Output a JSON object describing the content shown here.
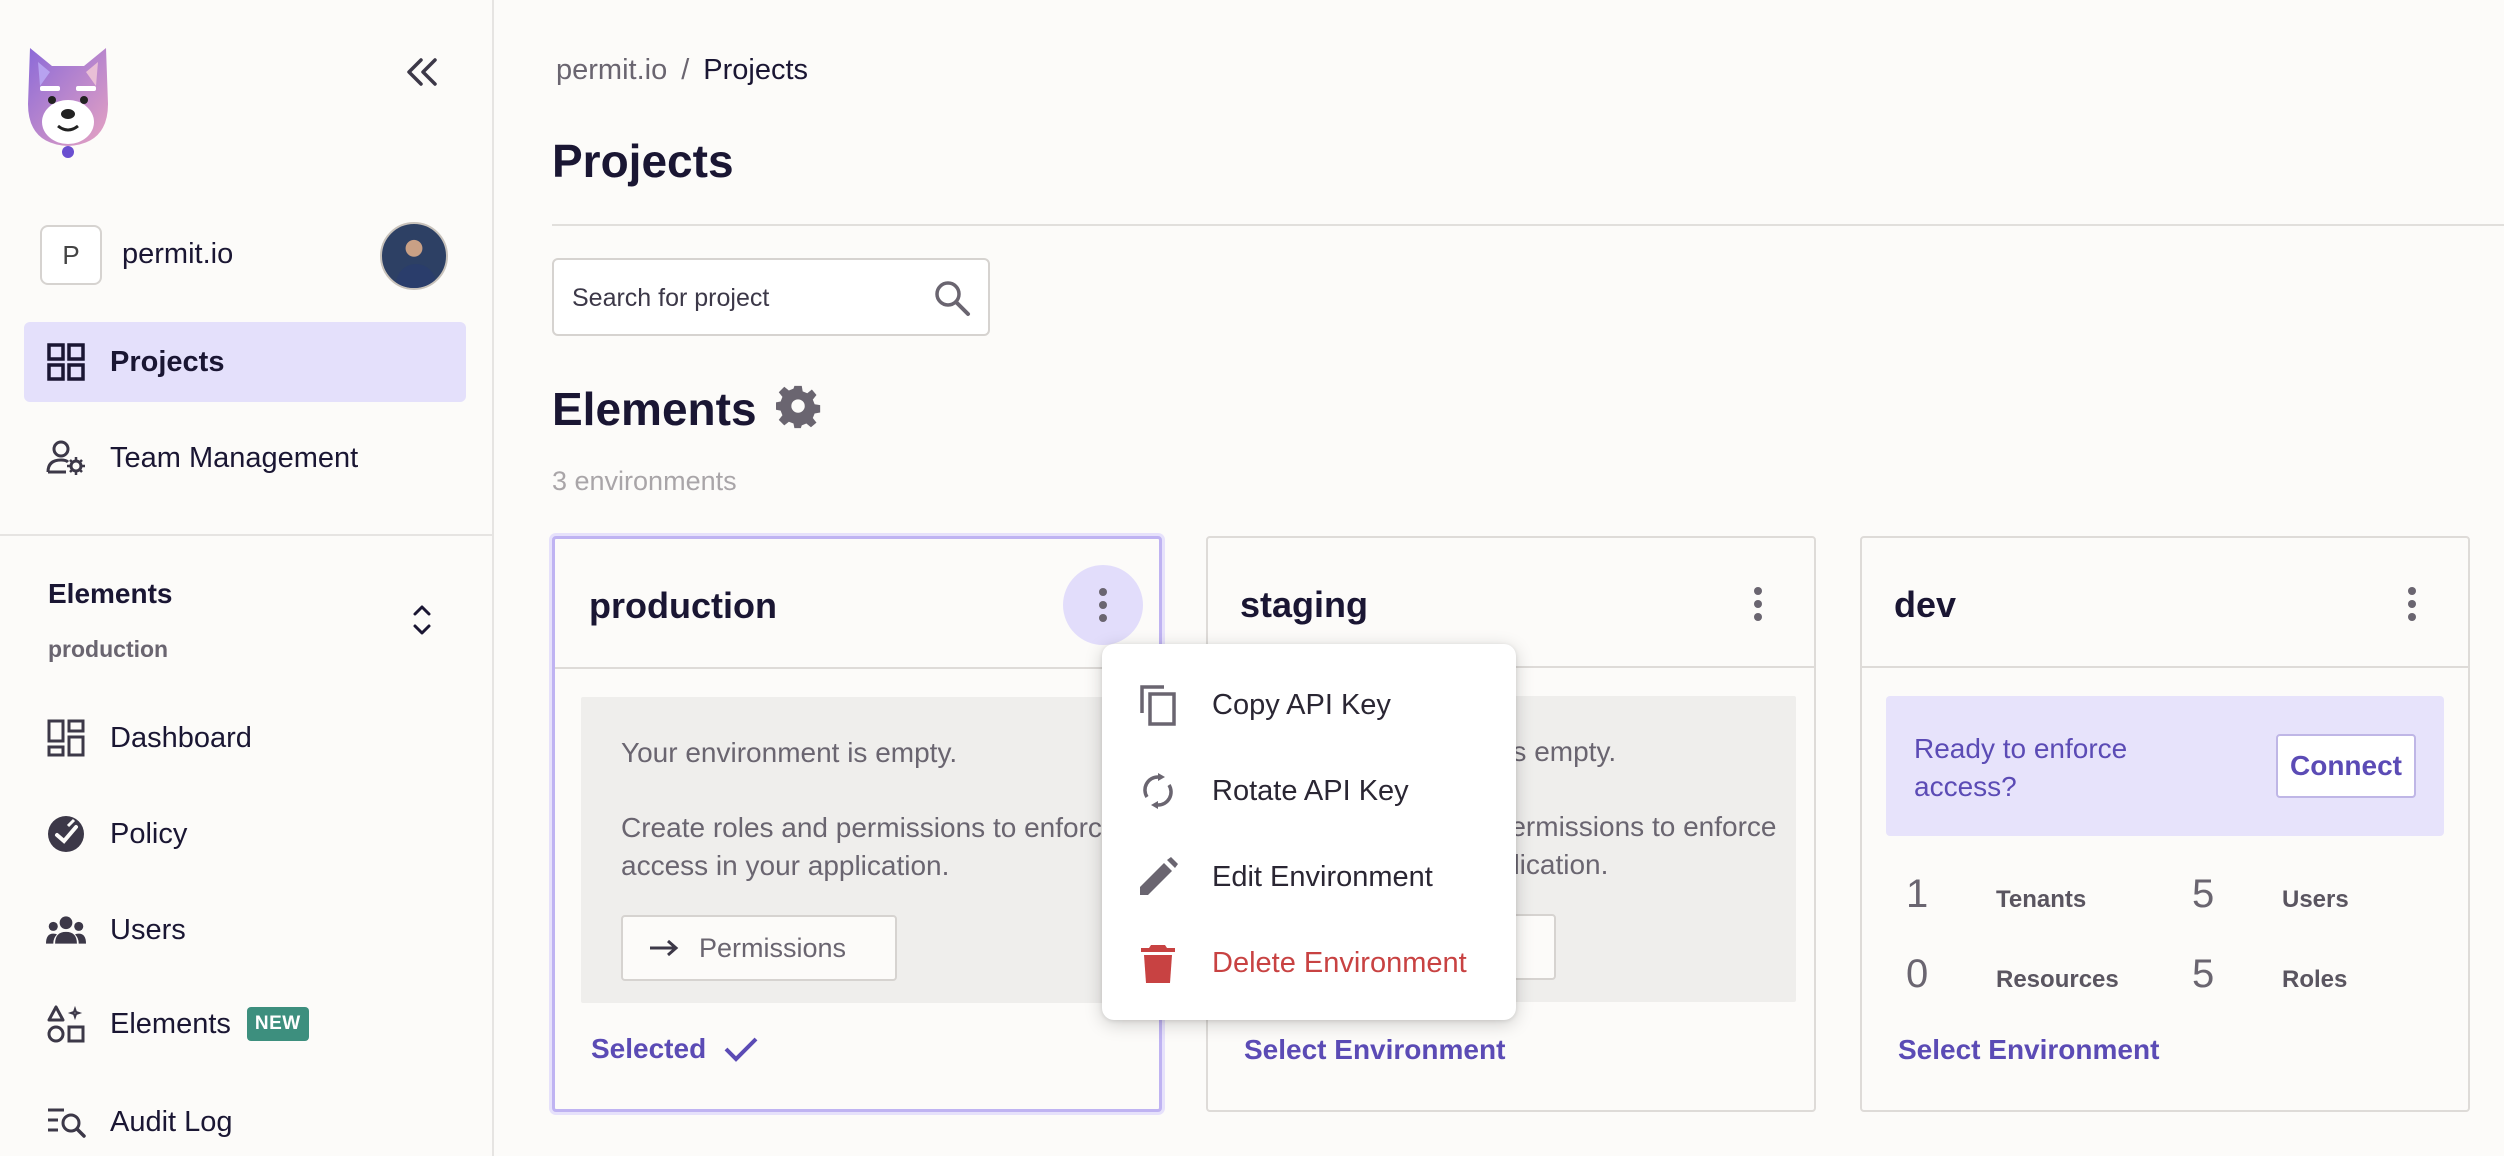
{
  "colors": {
    "accent": "#5b4bb5",
    "active_nav_bg": "#e4e0fb",
    "danger": "#c84242",
    "new_badge": "#3d8f7e"
  },
  "sidebar": {
    "org_initial": "P",
    "org_name": "permit.io",
    "nav_top": [
      {
        "label": "Projects",
        "icon": "grid-icon",
        "active": true
      },
      {
        "label": "Team Management",
        "icon": "user-gear-icon",
        "active": false
      }
    ],
    "project_switch": {
      "project": "Elements",
      "environment": "production"
    },
    "nav_env": [
      {
        "label": "Dashboard",
        "icon": "dashboard-icon"
      },
      {
        "label": "Policy",
        "icon": "policy-icon"
      },
      {
        "label": "Users",
        "icon": "users-icon"
      },
      {
        "label": "Elements",
        "icon": "elements-icon",
        "badge": "NEW"
      },
      {
        "label": "Audit Log",
        "icon": "audit-log-icon"
      }
    ]
  },
  "header": {
    "breadcrumb_root": "permit.io",
    "breadcrumb_sep": "/",
    "breadcrumb_current": "Projects",
    "page_title": "Projects"
  },
  "search": {
    "placeholder": "Search for project"
  },
  "project": {
    "name": "Elements",
    "env_count": "3 environments"
  },
  "environments": [
    {
      "name": "production",
      "selected": true,
      "empty_title": "Your environment is empty.",
      "empty_desc": "Create roles and permissions to enforce access in your application.",
      "permissions_button": "Permissions",
      "footer": "Selected"
    },
    {
      "name": "staging",
      "selected": false,
      "empty_title": "Your environment is empty.",
      "empty_desc": "Create roles and permissions to enforce access in your application.",
      "footer": "Select Environment"
    },
    {
      "name": "dev",
      "selected": false,
      "connect_msg": "Ready to enforce access?",
      "connect_button": "Connect",
      "stats": [
        {
          "value": "1",
          "label": "Tenants"
        },
        {
          "value": "5",
          "label": "Users"
        },
        {
          "value": "0",
          "label": "Resources"
        },
        {
          "value": "5",
          "label": "Roles"
        }
      ],
      "footer": "Select Environment"
    }
  ],
  "context_menu": {
    "items": [
      {
        "label": "Copy API Key",
        "icon": "copy-icon"
      },
      {
        "label": "Rotate API Key",
        "icon": "rotate-icon"
      },
      {
        "label": "Edit Environment",
        "icon": "pencil-icon"
      },
      {
        "label": "Delete Environment",
        "icon": "trash-icon",
        "danger": true
      }
    ]
  }
}
